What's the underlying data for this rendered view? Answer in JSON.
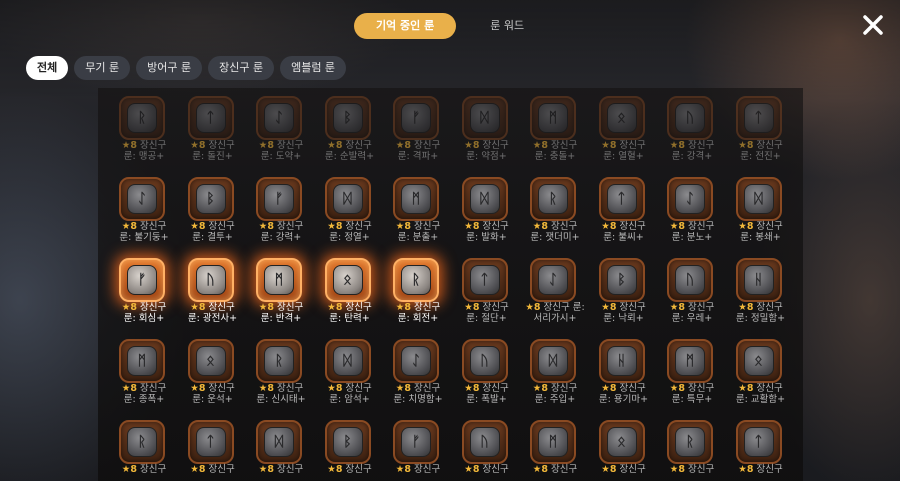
{
  "header": {
    "tabs": [
      {
        "label": "기억 중인 룬",
        "active": true
      },
      {
        "label": "룬 워드",
        "active": false
      }
    ],
    "close_icon": "close-x-icon"
  },
  "filters": [
    {
      "label": "전체",
      "active": true
    },
    {
      "label": "무기 룬",
      "active": false
    },
    {
      "label": "방어구 룬",
      "active": false
    },
    {
      "label": "장신구 룬",
      "active": false
    },
    {
      "label": "엠블럼 룬",
      "active": false
    }
  ],
  "colors": {
    "accent": "#e9b04a",
    "glow": "#ff7a20",
    "star": "#f2b83a"
  },
  "runes": [
    {
      "rune": "ᚱ",
      "stars": "★8",
      "type": "장신구",
      "name": "룬: 맹공+",
      "state": "dim"
    },
    {
      "rune": "ᛏ",
      "stars": "★8",
      "type": "장신구",
      "name": "룬: 돌진+",
      "state": "dim"
    },
    {
      "rune": "ᛇ",
      "stars": "★8",
      "type": "장신구",
      "name": "룬: 도약+",
      "state": "dim"
    },
    {
      "rune": "ᛒ",
      "stars": "★8",
      "type": "장신구",
      "name": "룬: 순발력+",
      "state": "dim"
    },
    {
      "rune": "ᚠ",
      "stars": "★8",
      "type": "장신구",
      "name": "룬: 격파+",
      "state": "dim"
    },
    {
      "rune": "ᛞ",
      "stars": "★8",
      "type": "장신구",
      "name": "룬: 약점+",
      "state": "dim"
    },
    {
      "rune": "ᛗ",
      "stars": "★8",
      "type": "장신구",
      "name": "룬: 충돌+",
      "state": "dim"
    },
    {
      "rune": "ᛟ",
      "stars": "★8",
      "type": "장신구",
      "name": "룬: 열혈+",
      "state": "dim"
    },
    {
      "rune": "ᚢ",
      "stars": "★8",
      "type": "장신구",
      "name": "룬: 강격+",
      "state": "dim"
    },
    {
      "rune": "ᛏ",
      "stars": "★8",
      "type": "장신구",
      "name": "룬: 전진+",
      "state": "dim"
    },
    {
      "rune": "ᛇ",
      "stars": "★8",
      "type": "장신구",
      "name": "룬: 불기둥+",
      "state": "normal"
    },
    {
      "rune": "ᛒ",
      "stars": "★8",
      "type": "장신구",
      "name": "룬: 결투+",
      "state": "normal"
    },
    {
      "rune": "ᚠ",
      "stars": "★8",
      "type": "장신구",
      "name": "룬: 강력+",
      "state": "normal"
    },
    {
      "rune": "ᛞ",
      "stars": "★8",
      "type": "장신구",
      "name": "룬: 정열+",
      "state": "normal"
    },
    {
      "rune": "ᛗ",
      "stars": "★8",
      "type": "장신구",
      "name": "룬: 분출+",
      "state": "normal"
    },
    {
      "rune": "ᛞ",
      "stars": "★8",
      "type": "장신구",
      "name": "룬: 발화+",
      "state": "normal"
    },
    {
      "rune": "ᚱ",
      "stars": "★8",
      "type": "장신구",
      "name": "룬: 잿더미+",
      "state": "normal"
    },
    {
      "rune": "ᛏ",
      "stars": "★8",
      "type": "장신구",
      "name": "룬: 불씨+",
      "state": "normal"
    },
    {
      "rune": "ᛇ",
      "stars": "★8",
      "type": "장신구",
      "name": "룬: 분노+",
      "state": "normal"
    },
    {
      "rune": "ᛞ",
      "stars": "★8",
      "type": "장신구",
      "name": "룬: 봉쇄+",
      "state": "normal"
    },
    {
      "rune": "ᚠ",
      "stars": "★8",
      "type": "장신구",
      "name": "룬: 회심+",
      "state": "lit"
    },
    {
      "rune": "ᚢ",
      "stars": "★8",
      "type": "장신구",
      "name": "룬: 광전사+",
      "state": "lit"
    },
    {
      "rune": "ᛗ",
      "stars": "★8",
      "type": "장신구",
      "name": "룬: 반격+",
      "state": "lit"
    },
    {
      "rune": "ᛟ",
      "stars": "★8",
      "type": "장신구",
      "name": "룬: 탄력+",
      "state": "lit"
    },
    {
      "rune": "ᚱ",
      "stars": "★8",
      "type": "장신구",
      "name": "룬: 회전+",
      "state": "lit"
    },
    {
      "rune": "ᛏ",
      "stars": "★8",
      "type": "장신구",
      "name": "룬: 절단+",
      "state": "normal"
    },
    {
      "rune": "ᛇ",
      "stars": "★8",
      "type": "장신구 룬:",
      "name": "서리가시+",
      "state": "normal"
    },
    {
      "rune": "ᛒ",
      "stars": "★8",
      "type": "장신구",
      "name": "룬: 낙뢰+",
      "state": "normal"
    },
    {
      "rune": "ᚢ",
      "stars": "★8",
      "type": "장신구",
      "name": "룬: 우레+",
      "state": "normal"
    },
    {
      "rune": "ᚺ",
      "stars": "★8",
      "type": "장신구",
      "name": "룬: 정밀함+",
      "state": "normal"
    },
    {
      "rune": "ᛗ",
      "stars": "★8",
      "type": "장신구",
      "name": "룬: 종폭+",
      "state": "normal"
    },
    {
      "rune": "ᛟ",
      "stars": "★8",
      "type": "장신구",
      "name": "룬: 운석+",
      "state": "normal"
    },
    {
      "rune": "ᚱ",
      "stars": "★8",
      "type": "장신구",
      "name": "룬: 신시태+",
      "state": "normal"
    },
    {
      "rune": "ᛞ",
      "stars": "★8",
      "type": "장신구",
      "name": "룬: 암석+",
      "state": "normal"
    },
    {
      "rune": "ᛇ",
      "stars": "★8",
      "type": "장신구",
      "name": "룬: 치명함+",
      "state": "normal"
    },
    {
      "rune": "ᚢ",
      "stars": "★8",
      "type": "장신구",
      "name": "룬: 폭발+",
      "state": "normal"
    },
    {
      "rune": "ᛞ",
      "stars": "★8",
      "type": "장신구",
      "name": "룬: 주입+",
      "state": "normal"
    },
    {
      "rune": "ᚺ",
      "stars": "★8",
      "type": "장신구",
      "name": "룬: 용기마+",
      "state": "normal"
    },
    {
      "rune": "ᛗ",
      "stars": "★8",
      "type": "장신구",
      "name": "룬: 특무+",
      "state": "normal"
    },
    {
      "rune": "ᛟ",
      "stars": "★8",
      "type": "장신구",
      "name": "룬: 교활함+",
      "state": "normal"
    },
    {
      "rune": "ᚱ",
      "stars": "★8",
      "type": "장신구",
      "name": "",
      "state": "normal"
    },
    {
      "rune": "ᛏ",
      "stars": "★8",
      "type": "장신구",
      "name": "",
      "state": "normal"
    },
    {
      "rune": "ᛞ",
      "stars": "★8",
      "type": "장신구",
      "name": "",
      "state": "normal"
    },
    {
      "rune": "ᛒ",
      "stars": "★8",
      "type": "장신구",
      "name": "",
      "state": "normal"
    },
    {
      "rune": "ᚠ",
      "stars": "★8",
      "type": "장신구",
      "name": "",
      "state": "normal"
    },
    {
      "rune": "ᚢ",
      "stars": "★8",
      "type": "장신구",
      "name": "",
      "state": "normal"
    },
    {
      "rune": "ᛗ",
      "stars": "★8",
      "type": "장신구",
      "name": "",
      "state": "normal"
    },
    {
      "rune": "ᛟ",
      "stars": "★8",
      "type": "장신구",
      "name": "",
      "state": "normal"
    },
    {
      "rune": "ᚱ",
      "stars": "★8",
      "type": "장신구",
      "name": "",
      "state": "normal"
    },
    {
      "rune": "ᛏ",
      "stars": "★8",
      "type": "장신구",
      "name": "",
      "state": "normal"
    }
  ]
}
